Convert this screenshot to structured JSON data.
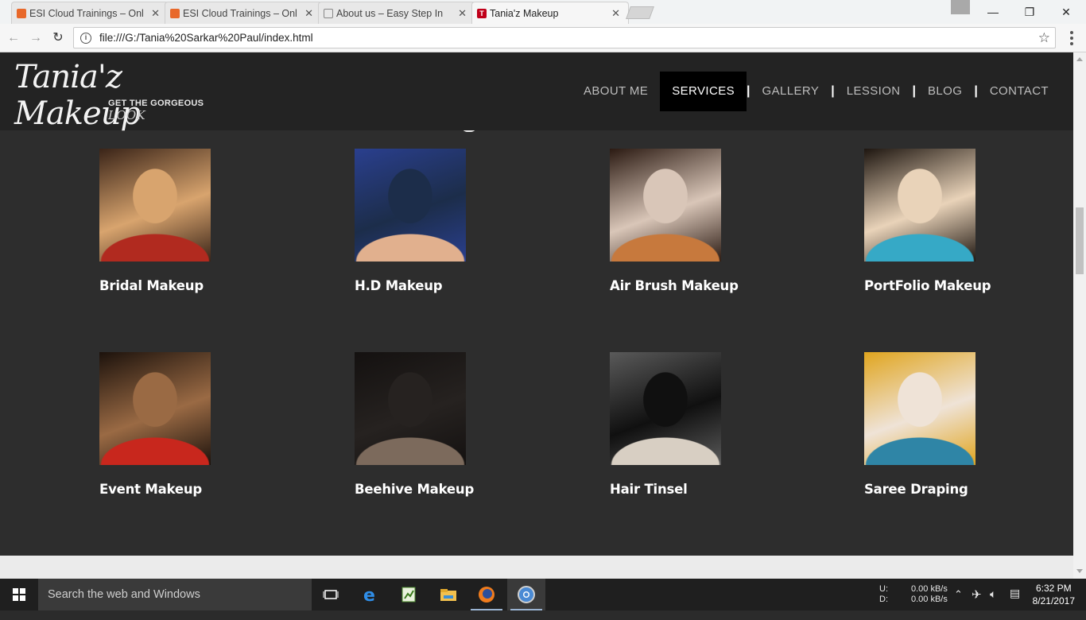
{
  "browser": {
    "tabs": [
      {
        "title": "ESI Cloud Trainings – Onl",
        "favicon_color": "#e8682a",
        "active": false
      },
      {
        "title": "ESI Cloud Trainings – Onl",
        "favicon_color": "#e8682a",
        "active": false
      },
      {
        "title": "About us – Easy Step In",
        "favicon_color": "#9a9a9a",
        "active": false
      },
      {
        "title": "Tania'z Makeup",
        "favicon_color": "#c0001a",
        "active": true
      }
    ],
    "url": "file:///G:/Tania%20Sarkar%20Paul/index.html"
  },
  "site": {
    "logo_script": "Tania'z Makeup",
    "logo_tagline": "GET THE GORGEOUS",
    "logo_tagline_end": "LOOK",
    "nav": [
      {
        "label": "ABOUT ME",
        "active": false
      },
      {
        "label": "SERVICES",
        "active": true
      },
      {
        "label": "GALLERY",
        "active": false
      },
      {
        "label": "LESSION",
        "active": false
      },
      {
        "label": "BLOG",
        "active": false
      },
      {
        "label": "CONTACT",
        "active": false
      }
    ],
    "services": [
      {
        "title": "Bridal Makeup",
        "palette": [
          "#d8a46e",
          "#b12a1f",
          "#3a2418"
        ]
      },
      {
        "title": "H.D Makeup",
        "palette": [
          "#1c2d4a",
          "#e1b08e",
          "#2a3f8e"
        ]
      },
      {
        "title": "Air Brush Makeup",
        "palette": [
          "#d9c6b8",
          "#c7793d",
          "#2b1a12"
        ]
      },
      {
        "title": "PortFolio Makeup",
        "palette": [
          "#e9d3b9",
          "#36a9c6",
          "#1e1610"
        ]
      },
      {
        "title": "Event Makeup",
        "palette": [
          "#9a6a44",
          "#c8271d",
          "#1c120c"
        ]
      },
      {
        "title": "Beehive Makeup",
        "palette": [
          "#262220",
          "#7c6a5c",
          "#141110"
        ]
      },
      {
        "title": "Hair Tinsel",
        "palette": [
          "#101010",
          "#d8cfc3",
          "#5a5a5a"
        ]
      },
      {
        "title": "Saree Draping",
        "palette": [
          "#efe3d7",
          "#2f85a6",
          "#e0a51f"
        ]
      }
    ]
  },
  "taskbar": {
    "search_placeholder": "Search the web and Windows",
    "net_up_label": "U:",
    "net_down_label": "D:",
    "net_up": "0.00 kB/s",
    "net_down": "0.00 kB/s",
    "time": "6:32 PM",
    "date": "8/21/2017"
  }
}
